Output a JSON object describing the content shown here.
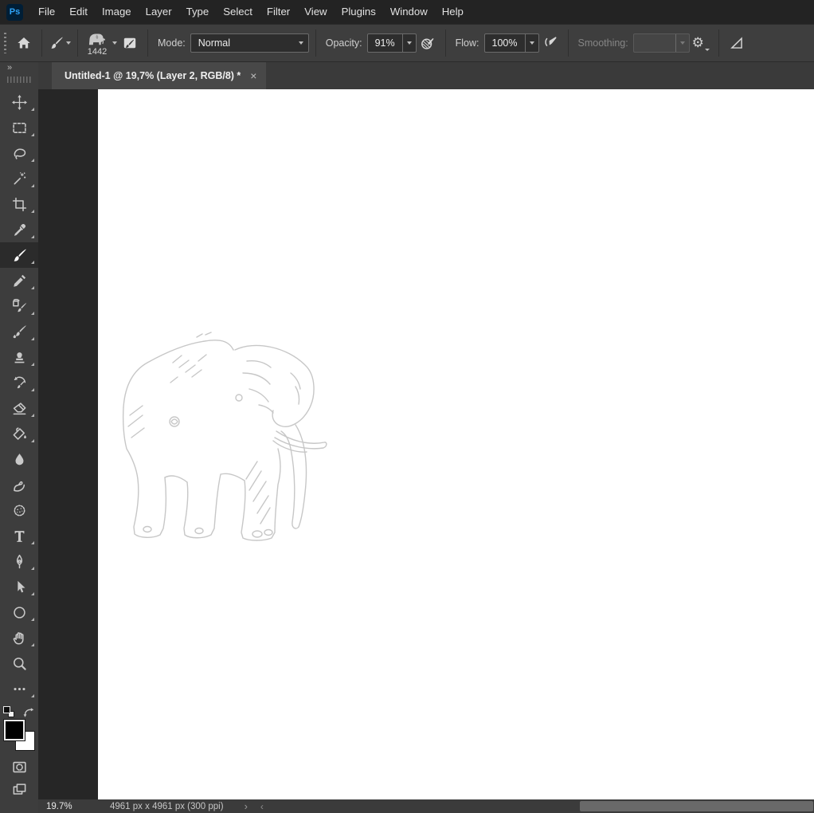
{
  "app": {
    "logo_text": "Ps"
  },
  "menubar": {
    "items": [
      "File",
      "Edit",
      "Image",
      "Layer",
      "Type",
      "Select",
      "Filter",
      "View",
      "Plugins",
      "Window",
      "Help"
    ]
  },
  "options_bar": {
    "tool_icon": "brush-tool-icon",
    "brush_preview": {
      "size": "1442",
      "icon": "elephant-brush-tip-thumbnail"
    },
    "mode": {
      "label": "Mode:",
      "value": "Normal"
    },
    "opacity": {
      "label": "Opacity:",
      "value": "91%"
    },
    "flow": {
      "label": "Flow:",
      "value": "100%"
    },
    "smoothing": {
      "label": "Smoothing:",
      "value": "",
      "disabled": true
    },
    "gear_glyph": "⚙",
    "icons": [
      "dock-grip",
      "home-icon",
      "brush-tool-icon",
      "toggle-brush-settings-icon",
      "pressure-opacity-icon",
      "airbrush-icon",
      "gear-icon",
      "brush-angle-icon"
    ]
  },
  "tabbar": {
    "collapse_glyph": "»",
    "tab": {
      "title": "Untitled-1 @ 19,7% (Layer 2, RGB/8) *",
      "close_glyph": "×",
      "active": true
    }
  },
  "toolbar": {
    "tools": [
      {
        "name": "move",
        "selected": false
      },
      {
        "name": "rectangular-marquee",
        "selected": false
      },
      {
        "name": "lasso",
        "selected": false
      },
      {
        "name": "magic-wand",
        "selected": false
      },
      {
        "name": "crop",
        "selected": false
      },
      {
        "name": "eyedropper",
        "selected": false
      },
      {
        "name": "brush",
        "selected": true
      },
      {
        "name": "pencil",
        "selected": false
      },
      {
        "name": "color-replacement",
        "selected": false
      },
      {
        "name": "mixer-brush",
        "selected": false
      },
      {
        "name": "clone-stamp",
        "selected": false
      },
      {
        "name": "history-brush",
        "selected": false
      },
      {
        "name": "eraser",
        "selected": false
      },
      {
        "name": "paint-bucket",
        "selected": false
      },
      {
        "name": "blur",
        "selected": false
      },
      {
        "name": "smudge",
        "selected": false
      },
      {
        "name": "sponge",
        "selected": false
      },
      {
        "name": "type",
        "selected": false
      },
      {
        "name": "pen",
        "selected": false
      },
      {
        "name": "path-selection",
        "selected": false
      },
      {
        "name": "ellipse",
        "selected": false
      },
      {
        "name": "hand",
        "selected": false
      },
      {
        "name": "zoom",
        "selected": false
      },
      {
        "name": "edit-toolbar-ellipsis",
        "selected": false
      }
    ],
    "foreground_color": "#000000",
    "background_color": "#ffffff"
  },
  "canvas": {
    "content": "light gray elephant outline sketch on white canvas"
  },
  "statusbar": {
    "zoom_level": "19.7%",
    "doc_info": "4961 px x 4961 px (300 ppi)",
    "popup_chevron": "›",
    "scroll_left_arrow": "‹"
  },
  "colors": {
    "ps_logo_bg": "#001e36",
    "ps_logo_text": "#2fa3f7",
    "menubar_bg": "#232323",
    "panel_bg": "#3e3e3e",
    "toolbar_bg": "#3d3d3d",
    "selected_tool_bg": "#2b2b2b",
    "pasteboard": "#262626",
    "canvas": "#ffffff",
    "active_tab_bg": "#484848"
  }
}
